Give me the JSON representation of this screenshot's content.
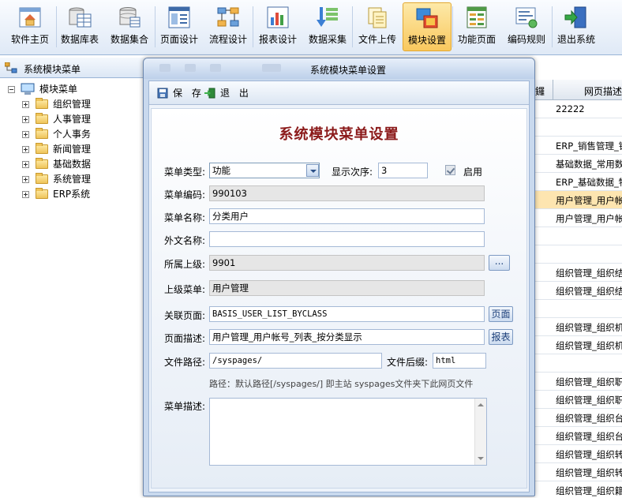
{
  "toolbar": {
    "items": [
      {
        "label": "软件主页",
        "icon": "home-icon"
      },
      {
        "label": "数据库表",
        "icon": "database-table-icon"
      },
      {
        "label": "数据集合",
        "icon": "dataset-icon"
      },
      {
        "label": "页面设计",
        "icon": "page-design-icon"
      },
      {
        "label": "流程设计",
        "icon": "flow-design-icon"
      },
      {
        "label": "报表设计",
        "icon": "report-chart-icon"
      },
      {
        "label": "数据采集",
        "icon": "data-collect-icon"
      },
      {
        "label": "文件上传",
        "icon": "file-upload-icon"
      },
      {
        "label": "模块设置",
        "icon": "module-settings-icon"
      },
      {
        "label": "功能页面",
        "icon": "function-page-icon"
      },
      {
        "label": "编码规则",
        "icon": "coding-rule-icon"
      },
      {
        "label": "退出系统",
        "icon": "exit-icon"
      }
    ],
    "active_index": 8
  },
  "left_panel": {
    "title": "系统模块菜单",
    "root": "模块菜单",
    "items": [
      "组织管理",
      "人事管理",
      "个人事务",
      "新闻管理",
      "基础数据",
      "系统管理",
      "ERP系统"
    ]
  },
  "grid": {
    "header_fragment": "鑼",
    "header": "网页描述",
    "rows": [
      "22222",
      "",
      "ERP_销售管理_销",
      "基础数据_常用数",
      "ERP_基础数据_物",
      "用户管理_用户帐",
      "用户管理_用户帐",
      "",
      "",
      "组织管理_组织结",
      "组织管理_组织结",
      "",
      "组织管理_组织机",
      "组织管理_组织机",
      "",
      "组织管理_组织职",
      "组织管理_组织职",
      "组织管理_组织台",
      "组织管理_组织台",
      "组织管理_组织转",
      "组织管理_组织转",
      "组织管理_组织籍"
    ],
    "selected_row": 5
  },
  "dialog": {
    "title": "系统模块菜单设置",
    "save": "保 存",
    "exit": "退 出",
    "form_title": "系统模块菜单设置",
    "menu_type_label": "菜单类型:",
    "menu_type_value": "功能",
    "order_label": "显示次序:",
    "order_value": "3",
    "enabled_label": "启用",
    "code_label": "菜单编码:",
    "code_value": "990103",
    "name_label": "菜单名称:",
    "name_value": "分类用户",
    "foreign_label": "外文名称:",
    "foreign_value": "",
    "parent_label": "所属上级:",
    "parent_value": "9901",
    "parent_btn": "...",
    "upper_label": "上级菜单:",
    "upper_value": "用户管理",
    "page_label": "关联页面:",
    "page_value": "BASIS_USER_LIST_BYCLASS",
    "page_btn": "页面",
    "desc_label": "页面描述:",
    "desc_value": "用户管理_用户帐号_列表_按分类显示",
    "desc_btn": "报表",
    "path_label": "文件路径:",
    "path_value": "/syspages/",
    "suffix_label": "文件后缀:",
    "suffix_value": "html",
    "path_hint": "路径：默认路径[/syspages/] 即主站 syspages文件夹下此网页文件",
    "menu_desc_label": "菜单描述:",
    "menu_desc_value": ""
  }
}
